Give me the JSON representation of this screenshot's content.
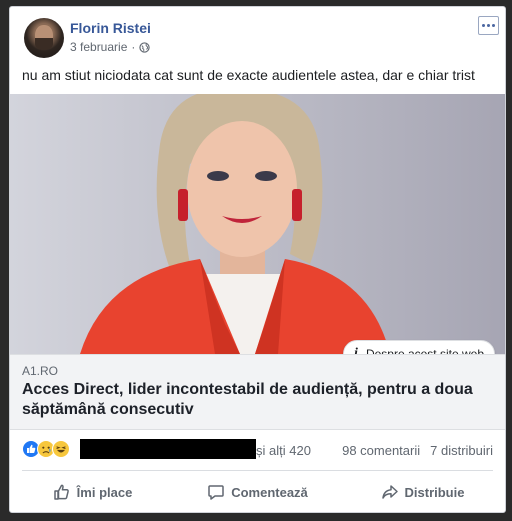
{
  "post": {
    "author": "Florin Ristei",
    "date": "3 februarie",
    "privacy_icon": "globe-icon",
    "text": "nu am stiut niciodata cat sunt de exacte audientele astea, dar e chiar trist"
  },
  "link": {
    "badge_label": "Despre acest site web",
    "domain": "A1.RO",
    "headline": "Acces Direct, lider incontestabil de audiență, pentru a doua săptămână consecutiv"
  },
  "stats": {
    "others": "și alți 420",
    "comments": "98 comentarii",
    "shares": "7 distribuiri"
  },
  "actions": {
    "like": "Îmi place",
    "comment": "Comentează",
    "share": "Distribuie"
  },
  "colors": {
    "author": "#385898",
    "like_blue": "#2078f4",
    "jacket_red": "#e8432f"
  }
}
